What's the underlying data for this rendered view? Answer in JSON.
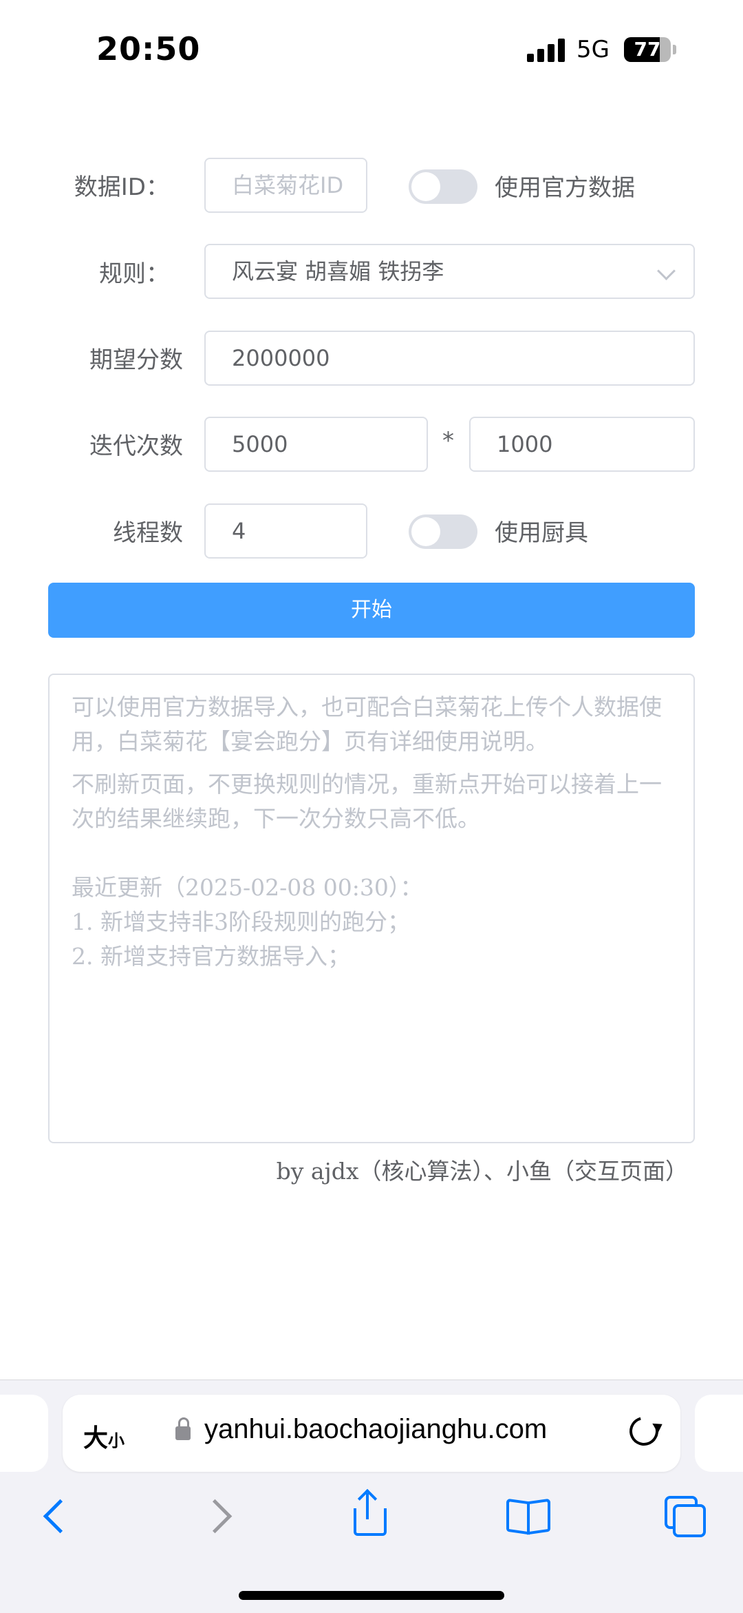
{
  "status": {
    "time": "20:50",
    "network": "5G",
    "battery": "77",
    "battery_level": 0.77
  },
  "form": {
    "data_id_label": "数据ID：",
    "data_id_placeholder": "白菜菊花ID",
    "official_toggle_label": "使用官方数据",
    "official_toggle_on": false,
    "rule_label": "规则：",
    "rule_value": "风云宴 胡喜媚 铁拐李",
    "target_label": "期望分数",
    "target_value": "2000000",
    "iter_label": "迭代次数",
    "iter_value_a": "5000",
    "iter_mult": "*",
    "iter_value_b": "1000",
    "threads_label": "线程数",
    "threads_value": "4",
    "tools_toggle_label": "使用厨具",
    "tools_toggle_on": false,
    "start_label": "开始"
  },
  "notes": {
    "line1": "可以使用官方数据导入，也可配合白菜菊花上传个人数据使用，白菜菊花【宴会跑分】页有详细使用说明。",
    "line2": "不刷新页面，不更换规则的情况，重新点开始可以接着上一次的结果继续跑，下一次分数只高不低。",
    "update_title": "最近更新（2025-02-08 00:30）：",
    "update_1": "1. 新增支持非3阶段规则的跑分；",
    "update_2": "2. 新增支持官方数据导入；"
  },
  "credit": "by ajdx（核心算法）、小鱼（交互页面）",
  "browser": {
    "text_size_big": "大",
    "text_size_small": "小",
    "url": "yanhui.baochaojianghu.com"
  }
}
